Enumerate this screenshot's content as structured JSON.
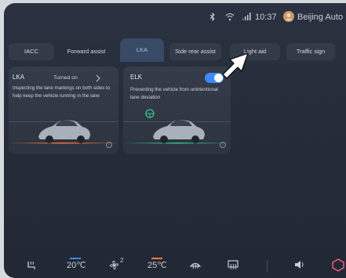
{
  "status": {
    "time": "10:37",
    "location": "Beijing Auto",
    "icons": [
      "bluetooth-icon",
      "wifi-icon",
      "cellular-signal-icon",
      "avatar"
    ]
  },
  "tabs": [
    {
      "label": "IACC"
    },
    {
      "label": "Forward assist"
    },
    {
      "label": "LKA"
    },
    {
      "label": "Side rear assist"
    },
    {
      "label": "Light aid"
    },
    {
      "label": "Traffic sign"
    }
  ],
  "lka_card": {
    "title": "LKA",
    "status": "Turned on",
    "description": "Inspecting the lane markings on both sides to help keep the vehicle running in the lane"
  },
  "elk_card": {
    "title": "ELK",
    "description": "Preventing the vehicle from unintentional lane deviation",
    "toggle_on": true
  },
  "dock": {
    "driver_temp": "20℃",
    "passenger_temp": "25℃",
    "fan_level": "2"
  },
  "colors": {
    "accent": "#3a8bff",
    "active_tab_text": "#9fc0ff",
    "lane_green": "#34c98a",
    "lane_orange": "#ff7a3c"
  }
}
